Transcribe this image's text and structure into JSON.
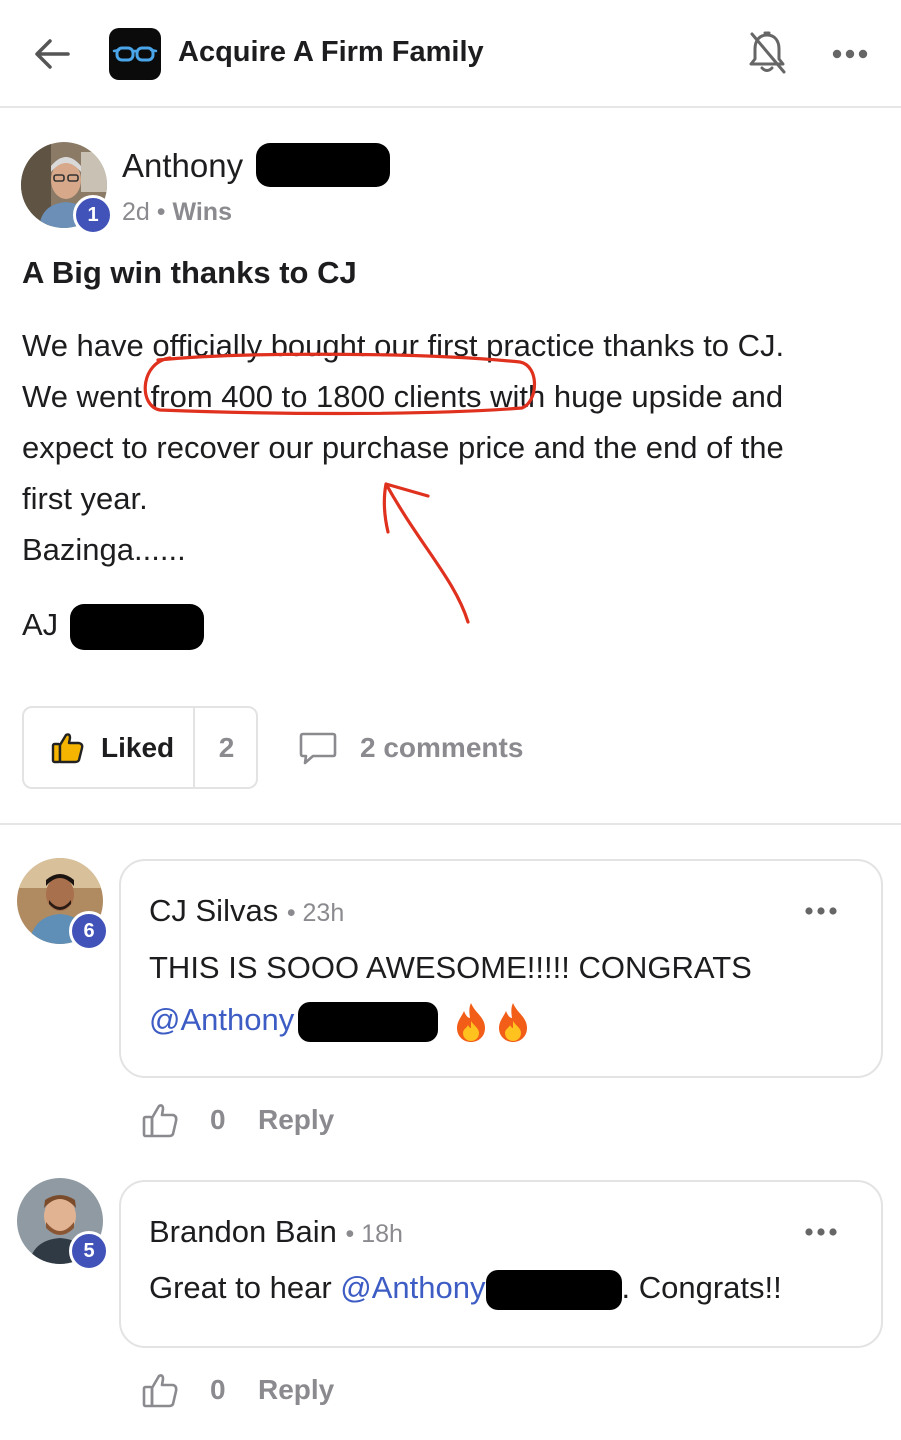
{
  "header": {
    "group_name": "Acquire A Firm Family",
    "back_icon": "back-arrow-icon",
    "bell_icon": "bell-off-icon",
    "more_icon": "more-horizontal-icon"
  },
  "post": {
    "author_first_name": "Anthony",
    "author_level": "1",
    "age": "2d",
    "separator": "•",
    "category": "Wins",
    "title": "A Big win thanks to CJ",
    "body_lines": [
      "We have officially bought our first practice thanks to CJ.",
      "We went from 400 to 1800 clients with huge upside and",
      "expect to recover our purchase price and the end of the",
      "first year.",
      "Bazinga......"
    ],
    "signature": "AJ",
    "liked_label": "Liked",
    "like_count": "2",
    "comments_label": "2 comments",
    "annotation_color": "#e0301e"
  },
  "comments": [
    {
      "author": "CJ Silvas",
      "level": "6",
      "time": "23h",
      "line1": "THIS IS SOOO AWESOME!!!!! CONGRATS",
      "mention": "@Anthony",
      "likes": "0",
      "reply_label": "Reply"
    },
    {
      "author": "Brandon Bain",
      "level": "5",
      "time": "18h",
      "text_before": "Great to hear ",
      "mention": "@Anthony",
      "text_after": ". Congrats!!",
      "likes": "0",
      "reply_label": "Reply"
    }
  ],
  "colors": {
    "accent_badge": "#4153b8",
    "mention": "#3d5cc4",
    "muted": "#8a8a8f"
  }
}
